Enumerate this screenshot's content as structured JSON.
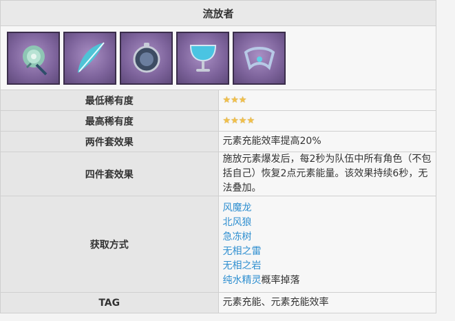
{
  "set": {
    "name": "流放者",
    "artifacts": [
      {
        "icon": "flower-icon"
      },
      {
        "icon": "feather-icon"
      },
      {
        "icon": "pocket-watch-icon"
      },
      {
        "icon": "goblet-icon"
      },
      {
        "icon": "circlet-icon"
      }
    ]
  },
  "rows": {
    "min_rarity": {
      "label": "最低稀有度",
      "stars": "★★★",
      "value": 3
    },
    "max_rarity": {
      "label": "最高稀有度",
      "stars": "★★★★",
      "value": 4
    },
    "two_piece": {
      "label": "两件套效果",
      "text": "元素充能效率提高20%"
    },
    "four_piece": {
      "label": "四件套效果",
      "text": "施放元素爆发后，每2秒为队伍中所有角色（不包括自己）恢复2点元素能量。该效果持续6秒，无法叠加。"
    },
    "source": {
      "label": "获取方式",
      "links": [
        "风魔龙",
        "北风狼",
        "急冻树",
        "无相之雷",
        "无相之岩",
        "纯水精灵"
      ],
      "last_suffix": "概率掉落"
    },
    "tag": {
      "label": "TAG",
      "text": "元素充能、元素充能效率"
    }
  },
  "colors": {
    "link": "#2f8fd0",
    "star": "#f1c04a",
    "thumb_bg": "#7d639b"
  }
}
